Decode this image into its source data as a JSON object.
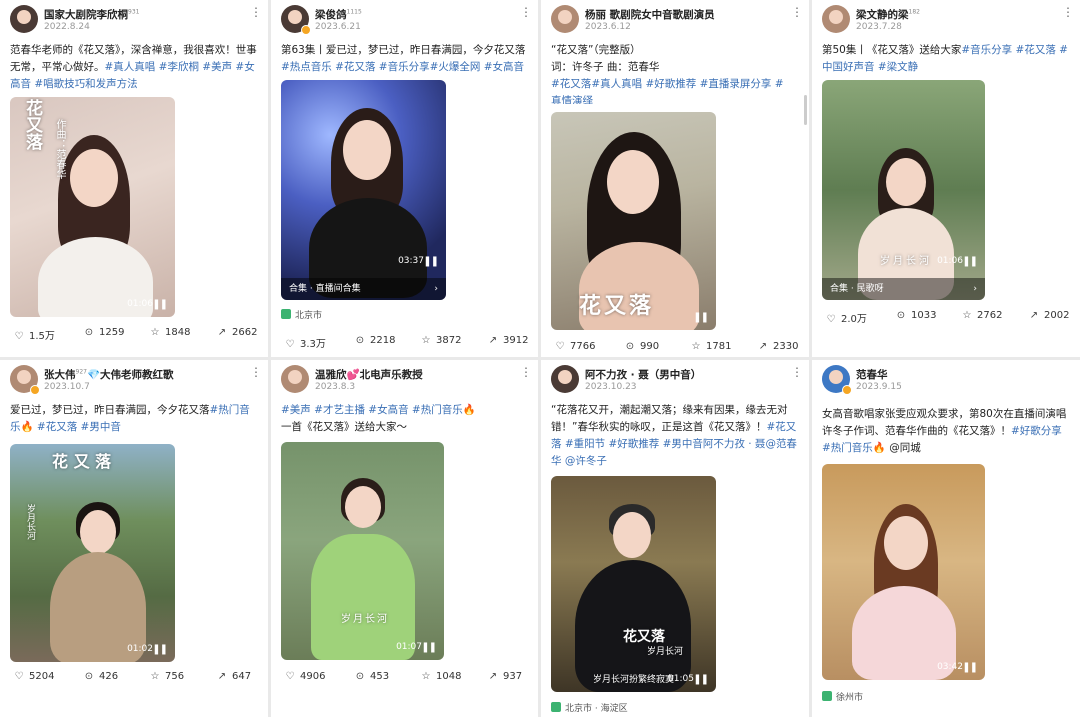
{
  "cards": [
    {
      "name": "国家大剧院李欣桐",
      "level": "931",
      "date": "2022.8.24",
      "text": [
        "范春华老师的《花又落》，深含禅意，我很喜欢！世事无常，平常心做好。",
        "#真人真唱",
        " #李欣桐",
        " #美声",
        " #女高音",
        " #唱歌技巧和发声方法"
      ],
      "overlay": "花又落",
      "overlay2": "作曲：范春华",
      "duration": "01:06",
      "actions": {
        "likes": "1.5万",
        "comments": "1259",
        "stars": "1848",
        "shares": "2662"
      }
    },
    {
      "name": "梁俊鸽",
      "level": "1115",
      "date": "2023.6.21",
      "text": [
        "第63集丨爱已过，梦已过，昨日春满园，今夕花又落",
        "#热点音乐",
        " #花又落",
        " #音乐分享",
        "#火爆全网",
        " #女高音"
      ],
      "duration": "03:37",
      "collection": "合集 · 直播间合集",
      "location": "北京市",
      "actions": {
        "likes": "3.3万",
        "comments": "2218",
        "stars": "3872",
        "shares": "3912"
      }
    },
    {
      "name": "杨丽 歌剧院女中音歌剧演员",
      "date": "2023.6.12",
      "text": [
        "“花又落”（完整版）",
        "词：许冬子 曲：范春华",
        "#花又落",
        "#真人真唱",
        " #好歌推荐",
        " #直播录屏分享",
        " #真情演绎"
      ],
      "overlay": "花又落",
      "actions": {
        "likes": "7766",
        "comments": "990",
        "stars": "1781",
        "shares": "2330"
      }
    },
    {
      "name": "梁文静的梁",
      "level": "182",
      "date": "2023.7.28",
      "text": [
        "第50集丨《花又落》送给大家",
        "#音乐分享",
        " #花又落",
        " #中国好声音",
        " #梁文静"
      ],
      "overlay": "岁月长河",
      "duration": "01:06",
      "collection": "合集 · 民歌呀",
      "actions": {
        "likes": "2.0万",
        "comments": "1033",
        "stars": "2762",
        "shares": "2002"
      }
    },
    {
      "name": "张大伟",
      "level": "927",
      "name2": "大伟老师教红歌",
      "date": "2023.10.7",
      "text": [
        "爱已过，梦已过，昨日春满园，今夕花又落",
        "#热门音乐",
        "🔥",
        " #花又落",
        " #男中音"
      ],
      "overlay": "花 又 落",
      "overlay2": "岁月长河",
      "duration": "01:02",
      "actions": {
        "likes": "5204",
        "comments": "426",
        "stars": "756",
        "shares": "647"
      }
    },
    {
      "name": "温雅欣",
      "name2": "北电声乐教授",
      "date": "2023.8.3",
      "text": [
        "#美声",
        " #才艺主播",
        " #女高音",
        " #热门音乐",
        "🔥",
        "一首《花又落》送给大家～"
      ],
      "overlay": "岁月长河",
      "duration": "01:07",
      "actions": {
        "likes": "4906",
        "comments": "453",
        "stars": "1048",
        "shares": "937"
      }
    },
    {
      "name": "阿不力孜 · 聂（男中音）",
      "date": "2023.10.23",
      "text": [
        "“花落花又开，潮起潮又落；缘来有因果，缘去无对错！”春华秋实的咏叹，正是这首《花又落》！",
        "#花又落",
        " #重阳节",
        " #好歌推荐",
        " #男中音阿不力孜 · 聂",
        "@范春华",
        " @许冬子"
      ],
      "overlay": "花又落",
      "overlay2": "岁月长河",
      "caption": "岁月长河扮繁终寂寞",
      "duration": "01:05",
      "location": "北京市 · 海淀区",
      "actions": {}
    },
    {
      "name": "范春华",
      "date": "2023.9.15",
      "text": [
        "女高音歌唱家张雯应观众要求，第80次在直播间演唱许冬子作词、范春华作曲的《花又落》！",
        "#好歌分享",
        " #热门音乐",
        "🔥",
        " @同城"
      ],
      "duration": "03:42",
      "location": "徐州市",
      "actions": {}
    }
  ],
  "icons": {
    "like": "heart-icon",
    "comment": "comment-icon",
    "star": "star-icon",
    "share": "share-icon"
  },
  "colors": {
    "tag": "#3a6fb5",
    "verified": "#f5a623",
    "location_pin": "#3cb371"
  }
}
